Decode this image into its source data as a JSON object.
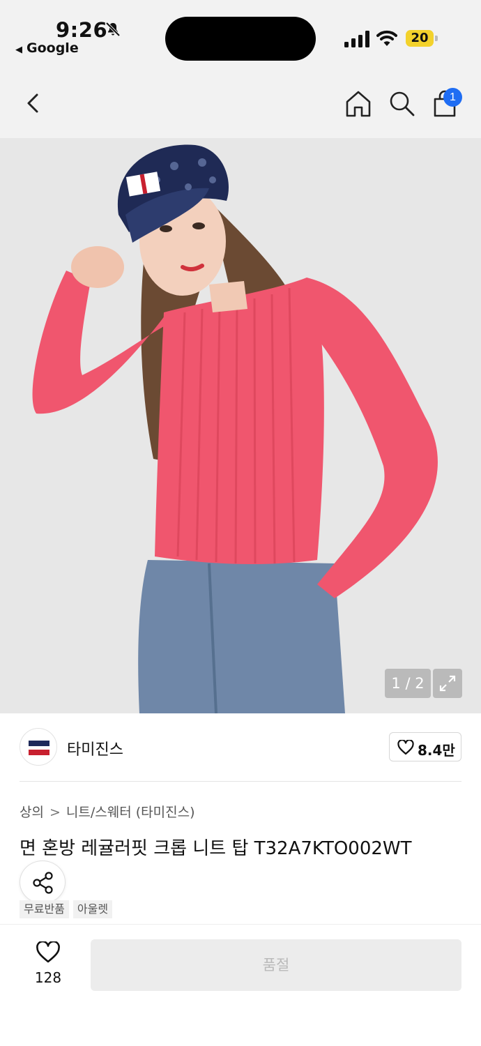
{
  "status_bar": {
    "time": "9:26",
    "back_app": "Google",
    "battery": "20"
  },
  "header": {
    "cart_count": "1"
  },
  "gallery": {
    "counter": "1 / 2"
  },
  "brand": {
    "name": "타미진스",
    "likes": "8.4만"
  },
  "breadcrumb": {
    "level1": "상의",
    "separator": ">",
    "level2": "니트/스웨터 (타미진스)"
  },
  "product": {
    "title": "면 혼방 레귤러핏 크롭 니트 탑 T32A7KTO002WT",
    "tags": [
      "무료반품",
      "아울렛"
    ]
  },
  "bottom": {
    "wish_count": "128",
    "buy_label": "품절"
  },
  "colors": {
    "accent_blue": "#1f6df3",
    "battery_yellow": "#f3d22c",
    "sweater_pink": "#f0566e"
  }
}
